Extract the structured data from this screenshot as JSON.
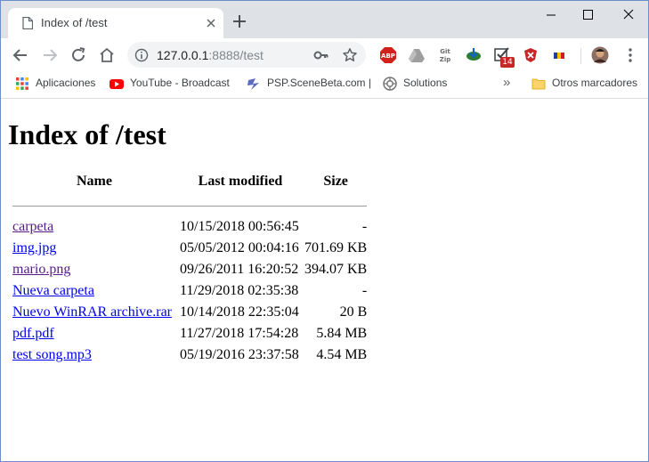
{
  "browser": {
    "tab_title": "Index of /test",
    "url_host": "127.0.0.1",
    "url_rest": ":8888/test",
    "extension_badge": "14"
  },
  "bookmarks": [
    {
      "label": "Aplicaciones",
      "icon": "apps-grid-icon"
    },
    {
      "label": "YouTube - Broadcast",
      "icon": "youtube-icon"
    },
    {
      "label": "PSP.SceneBeta.com |",
      "icon": "psp-scenebeta-icon"
    },
    {
      "label": "Solutions",
      "icon": "solutions-icon"
    }
  ],
  "bookmarks_overflow": "»",
  "other_bookmarks": "Otros marcadores",
  "page": {
    "heading": "Index of /test",
    "columns": {
      "name": "Name",
      "modified": "Last modified",
      "size": "Size"
    },
    "files": [
      {
        "name": "carpeta",
        "modified": "10/15/2018 00:56:45",
        "size": "-",
        "visited": true
      },
      {
        "name": "img.jpg",
        "modified": "05/05/2012 00:04:16",
        "size": "701.69 KB",
        "visited": false
      },
      {
        "name": "mario.png",
        "modified": "09/26/2011 16:20:52",
        "size": "394.07 KB",
        "visited": true
      },
      {
        "name": "Nueva carpeta",
        "modified": "11/29/2018 02:35:38",
        "size": "-",
        "visited": false
      },
      {
        "name": "Nuevo WinRAR archive.rar",
        "modified": "10/14/2018 22:35:04",
        "size": "20 B",
        "visited": false
      },
      {
        "name": "pdf.pdf",
        "modified": "11/27/2018 17:54:28",
        "size": "5.84 MB",
        "visited": false
      },
      {
        "name": "test song.mp3",
        "modified": "05/19/2016 23:37:58",
        "size": "4.54 MB",
        "visited": false
      }
    ]
  }
}
